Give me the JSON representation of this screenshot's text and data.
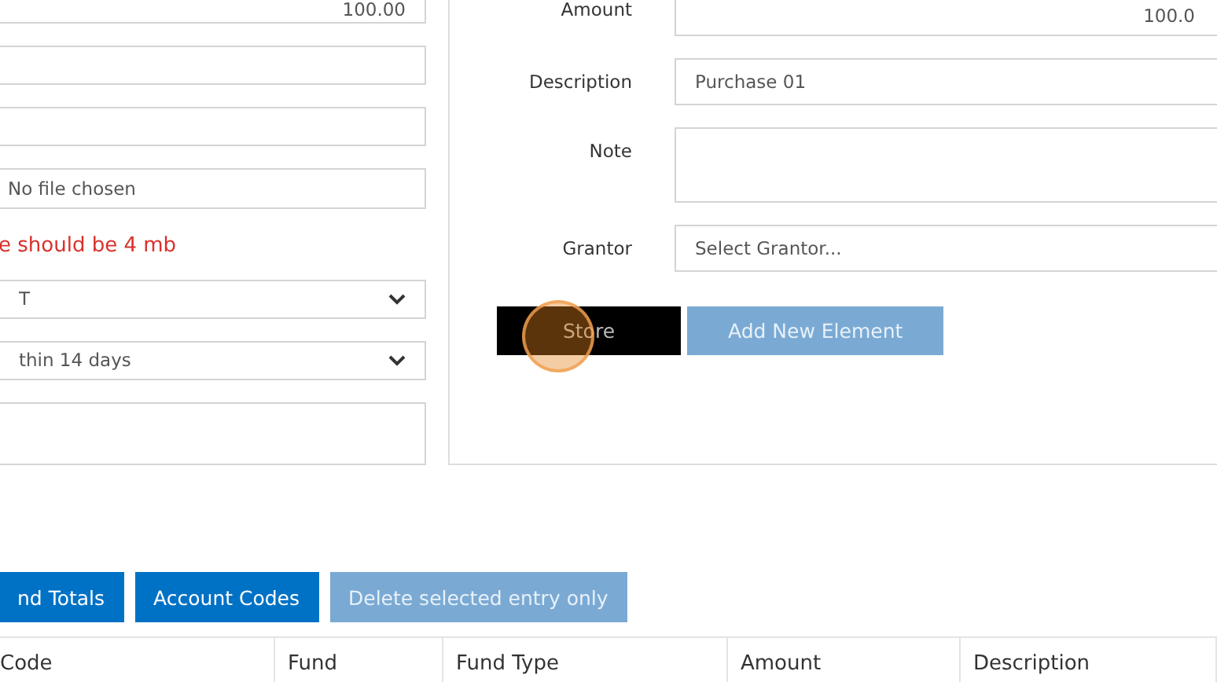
{
  "left_form": {
    "fields": [
      {
        "kind": "input",
        "value": "100.00"
      },
      {
        "kind": "input"
      },
      {
        "kind": "input"
      },
      {
        "kind": "file",
        "value": "No file chosen"
      },
      {
        "kind": "error",
        "text": "e should be 4 mb"
      },
      {
        "kind": "select",
        "value": "T"
      },
      {
        "kind": "select",
        "value": "thin 14 days"
      },
      {
        "kind": "textarea"
      }
    ]
  },
  "element_form": {
    "fields": [
      {
        "label": "Amount",
        "kind": "number",
        "value": "100.0"
      },
      {
        "label": "Description",
        "kind": "input",
        "value": "Purchase 01"
      },
      {
        "label": "Note",
        "kind": "textarea"
      },
      {
        "label": "Grantor",
        "kind": "select",
        "placeholder": "Select Grantor..."
      }
    ],
    "buttons": [
      {
        "label": "Store",
        "kind": "dark",
        "disabled": false,
        "clicked": true
      },
      {
        "label": "Add New Element",
        "kind": "primary",
        "disabled": true,
        "clicked": false
      }
    ]
  },
  "actions": [
    {
      "label": "nd Totals",
      "disabled": false
    },
    {
      "label": "Account Codes",
      "disabled": false
    },
    {
      "label": "Delete selected entry only",
      "disabled": true
    }
  ],
  "table": {
    "columns": [
      "Code",
      "Fund",
      "Fund Type",
      "Amount",
      "Description"
    ]
  }
}
